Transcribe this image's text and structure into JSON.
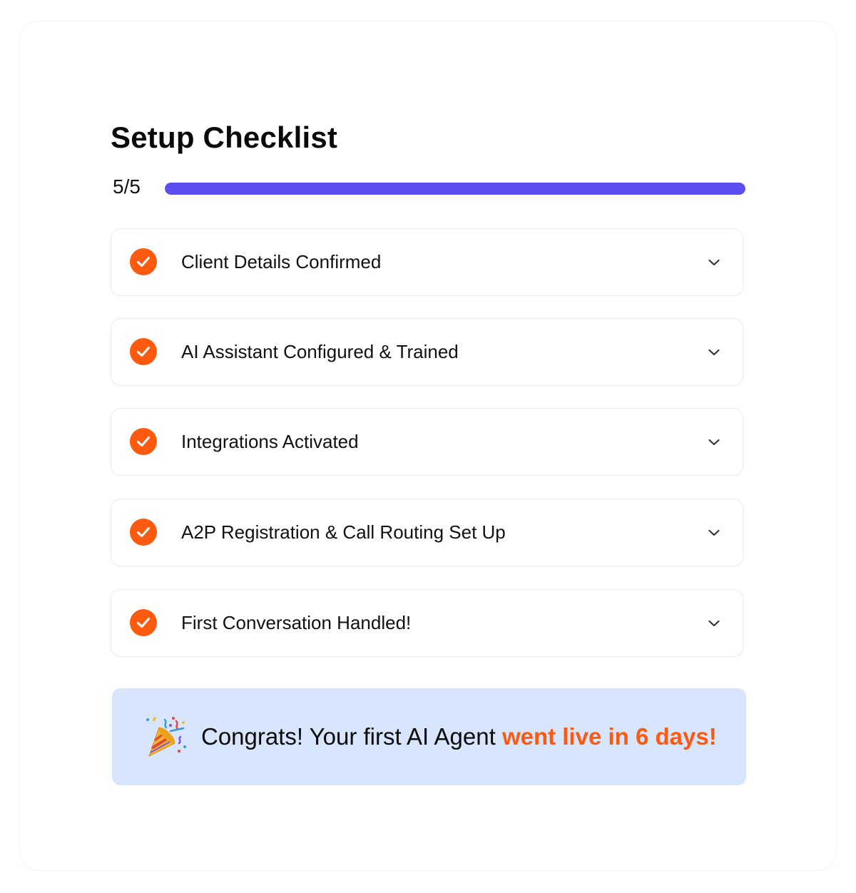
{
  "checklist": {
    "title": "Setup Checklist",
    "progress": {
      "label": "5/5",
      "completed": 5,
      "total": 5,
      "fraction": 1.0,
      "color": "#5b4ff0"
    },
    "accent_color": "#fd5a0f",
    "steps": [
      {
        "label": "Client Details Confirmed",
        "status": "complete"
      },
      {
        "label": "AI Assistant Configured & Trained",
        "status": "complete"
      },
      {
        "label": "Integrations Activated",
        "status": "complete"
      },
      {
        "label": "A2P Registration & Call Routing Set Up",
        "status": "complete"
      },
      {
        "label": "First Conversation Handled!",
        "status": "complete"
      }
    ],
    "icons": {
      "step_status": "check-circle-icon",
      "expand": "chevron-down-icon",
      "banner": "party-popper-icon"
    }
  },
  "banner": {
    "text_prefix": "Congrats! Your first AI Agent ",
    "text_highlight": "went live in 6 days!",
    "background": "#d7e5fd"
  }
}
